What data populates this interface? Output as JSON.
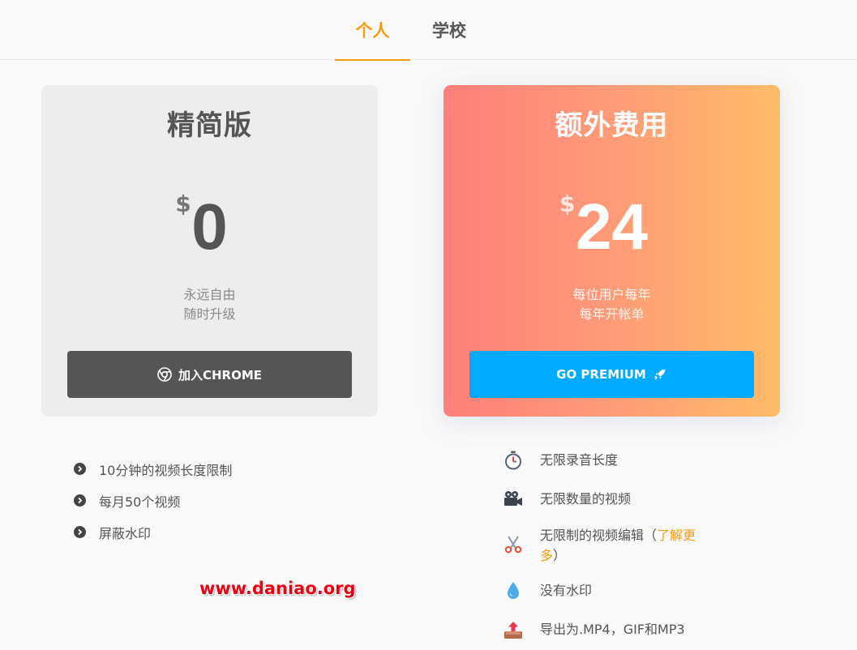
{
  "tabs": [
    {
      "label": "个人",
      "active": true
    },
    {
      "label": "学校",
      "active": false
    }
  ],
  "plans": {
    "free": {
      "title": "精简版",
      "currency": "$",
      "amount": "0",
      "sub_line1": "永远自由",
      "sub_line2": "随时升级",
      "button_label": "加入CHROME",
      "button_icon": "chrome-icon",
      "features": [
        "10分钟的视频长度限制",
        "每月50个视频",
        "屏蔽水印"
      ]
    },
    "premium": {
      "title": "额外费用",
      "currency": "$",
      "amount": "24",
      "sub_line1": "每位用户每年",
      "sub_line2": "每年开帐单",
      "button_label": "GO PREMIUM",
      "button_icon": "rocket-icon",
      "features": [
        {
          "icon": "stopwatch-icon",
          "text": "无限录音长度"
        },
        {
          "icon": "video-camera-icon",
          "text": "无限数量的视频"
        },
        {
          "icon": "scissors-icon",
          "text_before": "无限制的视频编辑（",
          "link": "了解更多",
          "text_after": "）"
        },
        {
          "icon": "droplet-icon",
          "text": "没有水印"
        },
        {
          "icon": "export-icon",
          "text": "导出为.MP4，GIF和MP3"
        }
      ]
    }
  },
  "watermark": "www.daniao.org",
  "colors": {
    "accent": "#f39c12",
    "premium_button": "#00aaff",
    "free_button": "#555555",
    "gradient_start": "#fe7f7a",
    "gradient_end": "#ffbc68"
  }
}
